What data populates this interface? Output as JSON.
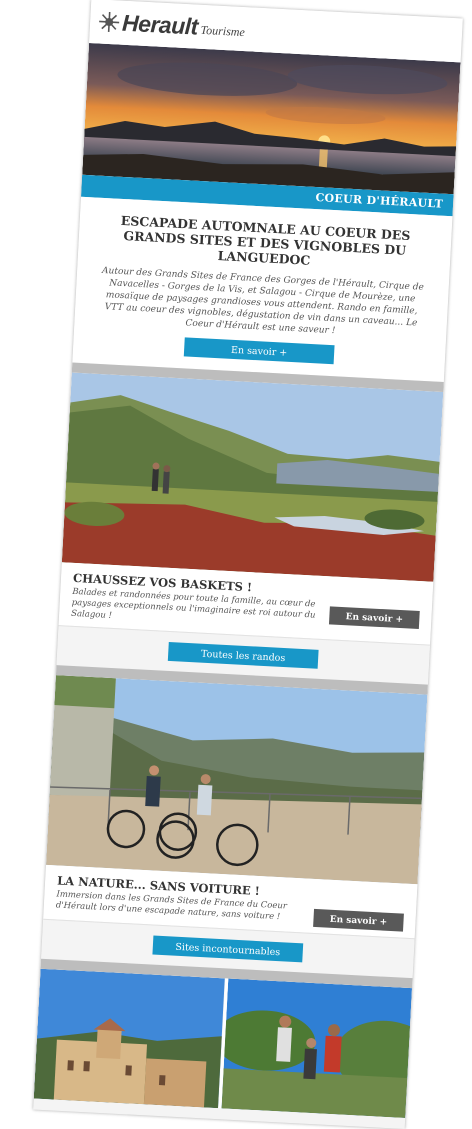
{
  "header": {
    "logo_main": "Herault",
    "logo_sub": "Tourisme",
    "logo_icon": "sun-star-icon"
  },
  "feature": {
    "ribbon": "COEUR D'HÉRAULT",
    "title": "ESCAPADE AUTOMNALE AU COEUR DES GRANDS SITES ET DES VIGNOBLES DU LANGUEDOC",
    "body": "Autour des Grands Sites de France des Gorges de l'Hérault, Cirque de Navacelles - Gorges de la Vis, et Salagou - Cirque de Mourèze, une mosaïque de paysages grandioses vous attendent. Rando en famille, VTT au coeur des vignobles, dégustation de vin dans un caveau... Le Coeur d'Hérault est une saveur !",
    "button": "En savoir +"
  },
  "hike": {
    "title": "CHAUSSEZ VOS BASKETS !",
    "body": "Balades et randonnées pour toute la famille, au cœur de paysages exceptionnels ou l'imaginaire est roi autour du Salagou !",
    "button": "En savoir +",
    "all_button": "Toutes les randos"
  },
  "bike": {
    "title": "LA NATURE... SANS VOITURE !",
    "body": "Immersion dans les Grands Sites de France du Coeur d'Hérault lors d'une escapade nature, sans voiture !",
    "button": "En savoir +",
    "all_button": "Sites incontournables"
  },
  "colors": {
    "accent_blue": "#1897c8",
    "button_grey": "#595959",
    "separator": "#bdbdbd"
  }
}
